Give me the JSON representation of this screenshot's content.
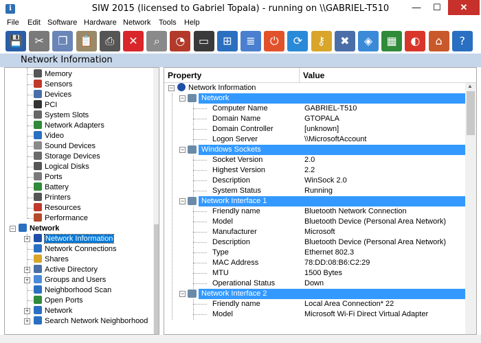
{
  "window": {
    "title": "SIW 2015 (licensed to Gabriel Topala) - running on \\\\GABRIEL-T510",
    "minimize": "—",
    "maximize": "☐",
    "close": "✕"
  },
  "menu": [
    "File",
    "Edit",
    "Software",
    "Hardware",
    "Network",
    "Tools",
    "Help"
  ],
  "toolbar": [
    {
      "name": "save-icon",
      "glyph": "💾",
      "color": "#2a5fa8"
    },
    {
      "name": "cut-icon",
      "glyph": "✂",
      "color": "#7a7a7a"
    },
    {
      "name": "copy-icon",
      "glyph": "❐",
      "color": "#6a86b8"
    },
    {
      "name": "paste-icon",
      "glyph": "📋",
      "color": "#9a8a6a"
    },
    {
      "name": "printer-icon",
      "glyph": "⎙",
      "color": "#555555"
    },
    {
      "name": "stop-icon",
      "glyph": "✕",
      "color": "#d9262b"
    },
    {
      "name": "find-icon",
      "glyph": "⌕",
      "color": "#8a8a8a"
    },
    {
      "name": "gauge-icon",
      "glyph": "◔",
      "color": "#b33a2a"
    },
    {
      "name": "monitor-icon",
      "glyph": "▭",
      "color": "#3a3a3a"
    },
    {
      "name": "network-pc-icon",
      "glyph": "⊞",
      "color": "#2b6fc1"
    },
    {
      "name": "list-icon",
      "glyph": "≣",
      "color": "#4a7fcf"
    },
    {
      "name": "shutdown-icon",
      "glyph": "⏻",
      "color": "#e2522a"
    },
    {
      "name": "refresh-icon",
      "glyph": "⟳",
      "color": "#2a8ad8"
    },
    {
      "name": "key-icon",
      "glyph": "⚷",
      "color": "#d9a52a"
    },
    {
      "name": "tools-icon",
      "glyph": "✖",
      "color": "#4a6fa8"
    },
    {
      "name": "box-icon",
      "glyph": "◈",
      "color": "#3a8ad8"
    },
    {
      "name": "memory-icon",
      "glyph": "▦",
      "color": "#2f8a3a"
    },
    {
      "name": "disk-icon",
      "glyph": "◐",
      "color": "#d9362b"
    },
    {
      "name": "home-icon",
      "glyph": "⌂",
      "color": "#c9592a"
    },
    {
      "name": "help-icon",
      "glyph": "?",
      "color": "#2a6fc1"
    }
  ],
  "page_header": "Network Information",
  "tree": {
    "hardware_children": [
      {
        "label": "Memory",
        "icon": "memory-icon",
        "color": "#555555"
      },
      {
        "label": "Sensors",
        "icon": "thermometer-icon",
        "color": "#c0392b"
      },
      {
        "label": "Devices",
        "icon": "devices-icon",
        "color": "#4a6fa8"
      },
      {
        "label": "PCI",
        "icon": "pci-icon",
        "color": "#333333"
      },
      {
        "label": "System Slots",
        "icon": "slots-icon",
        "color": "#666666"
      },
      {
        "label": "Network Adapters",
        "icon": "network-adapter-icon",
        "color": "#2f8a3a"
      },
      {
        "label": "Video",
        "icon": "video-icon",
        "color": "#2a6fc1"
      },
      {
        "label": "Sound Devices",
        "icon": "speaker-icon",
        "color": "#8a8a8a"
      },
      {
        "label": "Storage Devices",
        "icon": "storage-icon",
        "color": "#6a6a6a"
      },
      {
        "label": "Logical Disks",
        "icon": "disk-icon",
        "color": "#555555"
      },
      {
        "label": "Ports",
        "icon": "port-icon",
        "color": "#7a7a7a"
      },
      {
        "label": "Battery",
        "icon": "battery-icon",
        "color": "#2f8a3a"
      },
      {
        "label": "Printers",
        "icon": "printer-icon",
        "color": "#555555"
      },
      {
        "label": "Resources",
        "icon": "resources-icon",
        "color": "#c0392b"
      },
      {
        "label": "Performance",
        "icon": "performance-icon",
        "color": "#b34a2a"
      }
    ],
    "network_label": "Network",
    "network_children": [
      {
        "label": "Network Information",
        "icon": "info-icon",
        "color": "#1f4fa8",
        "selected": true,
        "expander": "+"
      },
      {
        "label": "Network Connections",
        "icon": "connections-icon",
        "color": "#2a6fc1",
        "expander": ""
      },
      {
        "label": "Shares",
        "icon": "shares-icon",
        "color": "#d9a52a",
        "expander": ""
      },
      {
        "label": "Active Directory",
        "icon": "directory-icon",
        "color": "#4a6fa8",
        "expander": "+"
      },
      {
        "label": "Groups and Users",
        "icon": "users-icon",
        "color": "#4a8ad8",
        "expander": "+"
      },
      {
        "label": "Neighborhood Scan",
        "icon": "scan-icon",
        "color": "#2a6fc1",
        "expander": ""
      },
      {
        "label": "Open Ports",
        "icon": "port-icon",
        "color": "#2f8a3a",
        "expander": ""
      },
      {
        "label": "Network",
        "icon": "network-icon",
        "color": "#2a6fc1",
        "expander": "+"
      },
      {
        "label": "Search Network Neighborhood",
        "icon": "search-network-icon",
        "color": "#2a6fc1",
        "expander": "+"
      }
    ]
  },
  "details": {
    "col_property": "Property",
    "col_value": "Value",
    "root_label": "Network Information",
    "rows": [
      {
        "type": "section",
        "label": "Network",
        "icon": "network-icon"
      },
      {
        "type": "item",
        "prop": "Computer Name",
        "val": "GABRIEL-T510"
      },
      {
        "type": "item",
        "prop": "Domain Name",
        "val": "GTOPALA"
      },
      {
        "type": "item",
        "prop": "Domain Controller",
        "val": "[unknown]"
      },
      {
        "type": "item",
        "prop": "Logon Server",
        "val": "\\\\MicrosoftAccount"
      },
      {
        "type": "section",
        "label": "Windows Sockets",
        "icon": "sockets-icon"
      },
      {
        "type": "item",
        "prop": "Socket Version",
        "val": "2.0"
      },
      {
        "type": "item",
        "prop": "Highest Version",
        "val": "2.2"
      },
      {
        "type": "item",
        "prop": "Description",
        "val": "WinSock 2.0"
      },
      {
        "type": "item",
        "prop": "System Status",
        "val": "Running"
      },
      {
        "type": "section",
        "label": "Network Interface 1",
        "icon": "nic-icon"
      },
      {
        "type": "item",
        "prop": "Friendly name",
        "val": "Bluetooth Network Connection"
      },
      {
        "type": "item",
        "prop": "Model",
        "val": "Bluetooth Device (Personal Area Network)"
      },
      {
        "type": "item",
        "prop": "Manufacturer",
        "val": "Microsoft"
      },
      {
        "type": "item",
        "prop": "Description",
        "val": "Bluetooth Device (Personal Area Network)"
      },
      {
        "type": "item",
        "prop": "Type",
        "val": "Ethernet 802.3"
      },
      {
        "type": "item",
        "prop": "MAC Address",
        "val": "78:DD:08:B6:C2:29"
      },
      {
        "type": "item",
        "prop": "MTU",
        "val": "1500 Bytes"
      },
      {
        "type": "item",
        "prop": "Operational Status",
        "val": "Down"
      },
      {
        "type": "section",
        "label": "Network Interface 2",
        "icon": "nic-icon"
      },
      {
        "type": "item",
        "prop": "Friendly name",
        "val": "Local Area Connection* 22"
      },
      {
        "type": "item",
        "prop": "Model",
        "val": "Microsoft Wi-Fi Direct Virtual Adapter"
      }
    ]
  },
  "colors": {
    "selection": "#3399ff",
    "header_band": "#c6d6ea",
    "close_button": "#c7312b"
  }
}
